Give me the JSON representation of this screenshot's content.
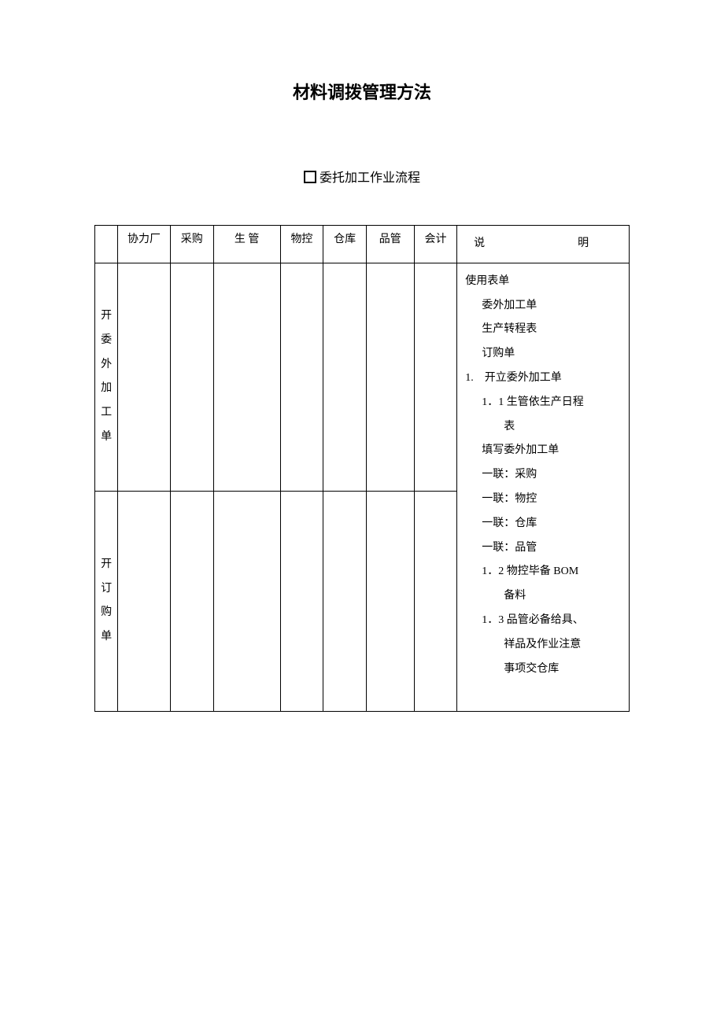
{
  "title": "材料调拨管理方法",
  "subtitle": "委托加工作业流程",
  "headers": {
    "col0": "",
    "col1": "协力厂",
    "col2": "采购",
    "col3": "生 管",
    "col4": "物控",
    "col5": "仓库",
    "col6": "品管",
    "col7": "会计",
    "col8": "说　　明"
  },
  "rows": {
    "row1_label": "开委外加工单",
    "row2_label": "开订购单"
  },
  "description": {
    "line1": "使用表单",
    "line2": "委外加工单",
    "line3": "生产转程表",
    "line4": "订购单",
    "line5": "1.　开立委外加工单",
    "line6": "1．1 生管依生产日程",
    "line6b": "表",
    "line7": "填写委外加工单",
    "line8": "一联：采购",
    "line9": "一联：物控",
    "line10": "一联：仓库",
    "line11": "一联：品管",
    "line12": "1．2 物控毕备 BOM",
    "line12b": "备料",
    "line13": "1．3 品管必备给具、",
    "line13b": "祥品及作业注意",
    "line13c": "事项交仓库"
  }
}
